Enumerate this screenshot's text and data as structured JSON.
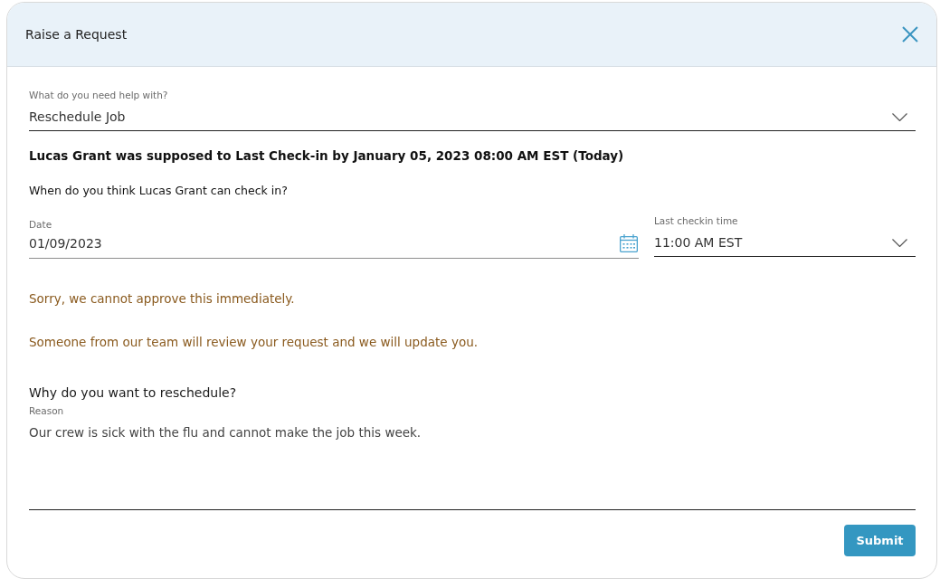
{
  "dialog": {
    "title": "Raise a Request"
  },
  "help_select": {
    "label": "What do you need help with?",
    "value": "Reschedule Job"
  },
  "notice": "Lucas Grant was supposed to Last Check-in by January 05, 2023 08:00 AM EST (Today)",
  "question": "When do you think Lucas Grant can check in?",
  "date_field": {
    "label": "Date",
    "value": "01/09/2023"
  },
  "time_select": {
    "label": "Last checkin time",
    "value": "11:00 AM EST"
  },
  "warning_messages": [
    "Sorry, we cannot approve this immediately.",
    "Someone from our team will review your request and we will update you."
  ],
  "reason_section": {
    "heading": "Why do you want to reschedule?",
    "label": "Reason",
    "value": "Our crew is sick with the flu and cannot make the job this week."
  },
  "buttons": [
    "Submit"
  ]
}
